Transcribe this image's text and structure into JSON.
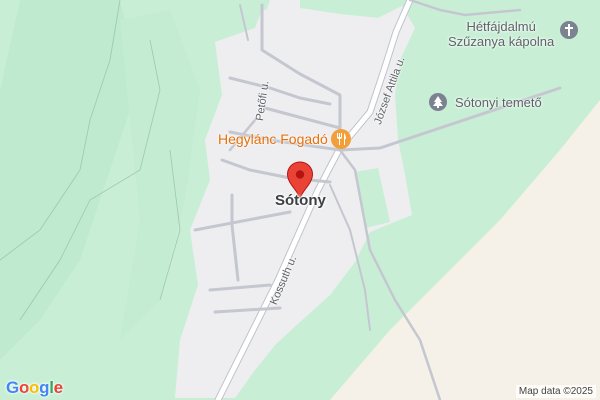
{
  "map": {
    "place_name": "Sótony",
    "streets": {
      "jozsef_attila": "József Attila u.",
      "kossuth": "Kossuth u.",
      "petofi": "Petőfi u."
    },
    "pois": {
      "restaurant": "Hegylánc Fogadó",
      "cemetery": "Sótonyi temető",
      "chapel_line1": "Hétfájdalmú",
      "chapel_line2": "Szűzanya kápolna"
    },
    "icons": {
      "restaurant": "fork-knife-icon",
      "cemetery": "tree-memorial-icon",
      "chapel": "cross-icon",
      "marker": "map-pin-icon"
    },
    "colors": {
      "forest": "#c8efd6",
      "forest_dark": "#aee3c0",
      "urban": "#eeeef1",
      "sand": "#f5f1e8",
      "road": "#c4c7cf",
      "pin": "#ea4335",
      "food": "#f29e39",
      "gray_poi": "#7b8290"
    }
  },
  "footer": {
    "logo": "Google",
    "attribution": "Map data ©2025"
  }
}
